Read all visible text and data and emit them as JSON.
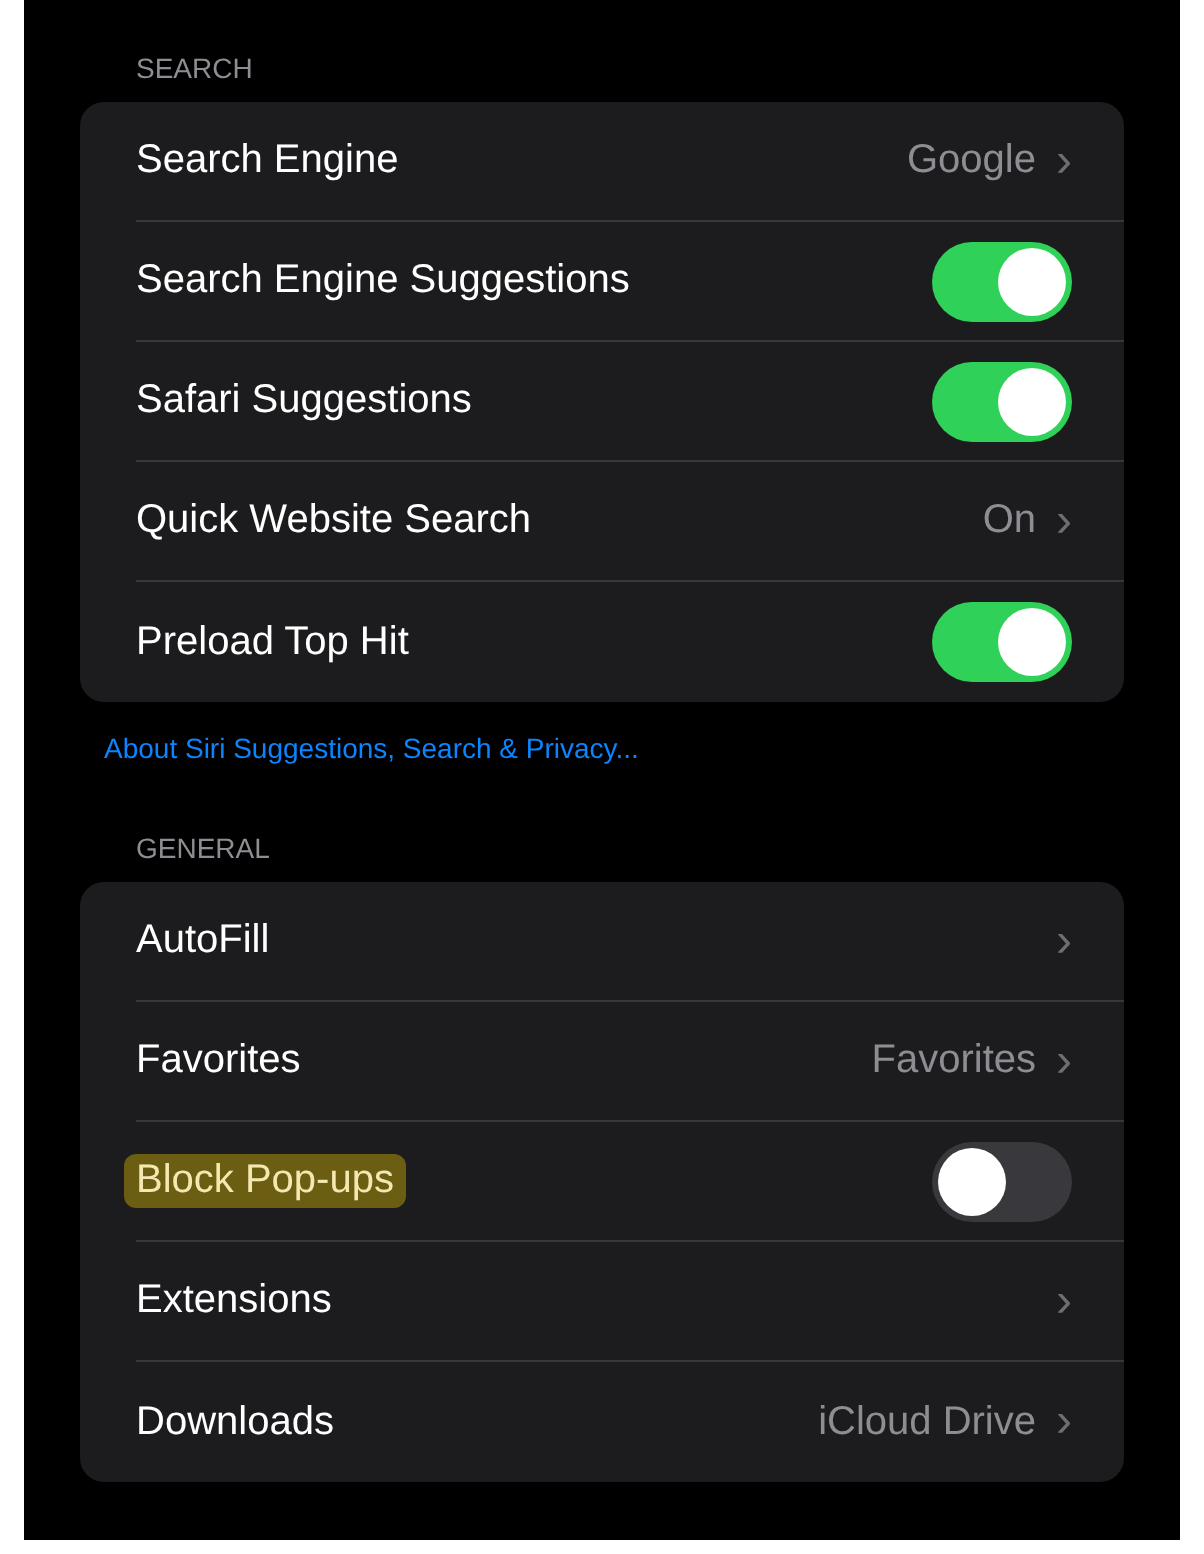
{
  "sections": [
    {
      "header": "SEARCH",
      "rows": [
        {
          "kind": "value",
          "label": "Search Engine",
          "value": "Google",
          "chevron": "›"
        },
        {
          "kind": "toggle",
          "label": "Search Engine Suggestions",
          "on": true
        },
        {
          "kind": "toggle",
          "label": "Safari Suggestions",
          "on": true
        },
        {
          "kind": "value",
          "label": "Quick Website Search",
          "value": "On",
          "chevron": "›"
        },
        {
          "kind": "toggle",
          "label": "Preload Top Hit",
          "on": true
        }
      ],
      "footer_link": "About Siri Suggestions, Search & Privacy..."
    },
    {
      "header": "GENERAL",
      "rows": [
        {
          "kind": "value",
          "label": "AutoFill",
          "chevron": "›"
        },
        {
          "kind": "value",
          "label": "Favorites",
          "value": "Favorites",
          "chevron": "›"
        },
        {
          "kind": "toggle",
          "label": "Block Pop-ups",
          "on": false,
          "highlighted": true
        },
        {
          "kind": "value",
          "label": "Extensions",
          "chevron": "›"
        },
        {
          "kind": "value",
          "label": "Downloads",
          "value": "iCloud Drive",
          "chevron": "›"
        }
      ]
    }
  ]
}
